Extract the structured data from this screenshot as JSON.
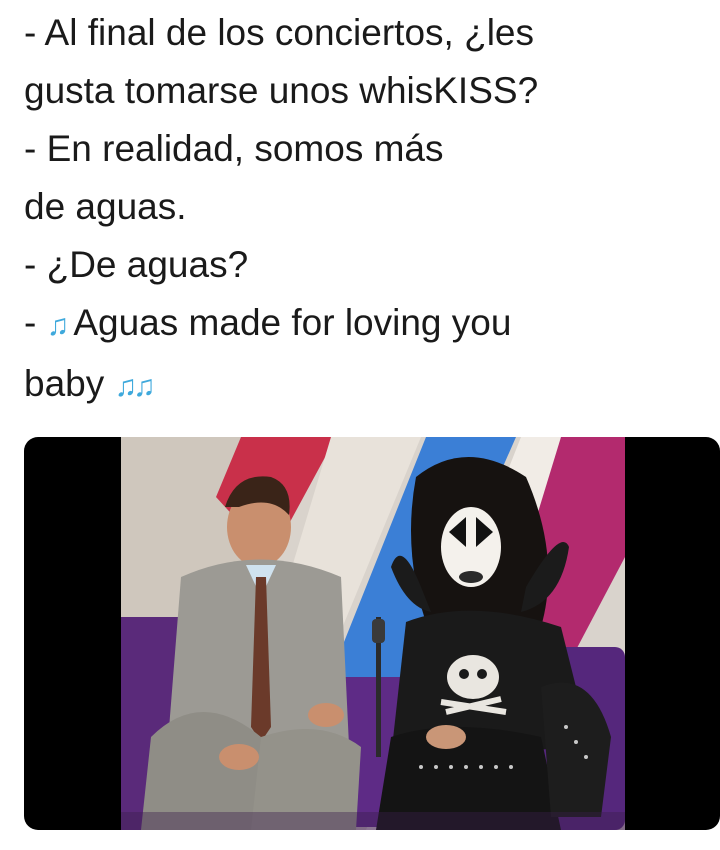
{
  "caption": {
    "lines": [
      "- Al final de los conciertos, ¿les",
      "gusta tomarse unos whisKISS?",
      "- En realidad, somos más",
      "de aguas.",
      "- ¿De aguas?"
    ],
    "line6_prefix": "- ",
    "line6_notes": "♫",
    "line6_text": " Aguas made for loving you",
    "line7_text": "baby ",
    "line7_notes": "♫♫"
  },
  "video": {
    "description_icon": "tv-interview-still",
    "watermark": ""
  },
  "colors": {
    "text": "#1a1a1a",
    "note": "#3fa9dc",
    "letterbox": "#000000"
  }
}
